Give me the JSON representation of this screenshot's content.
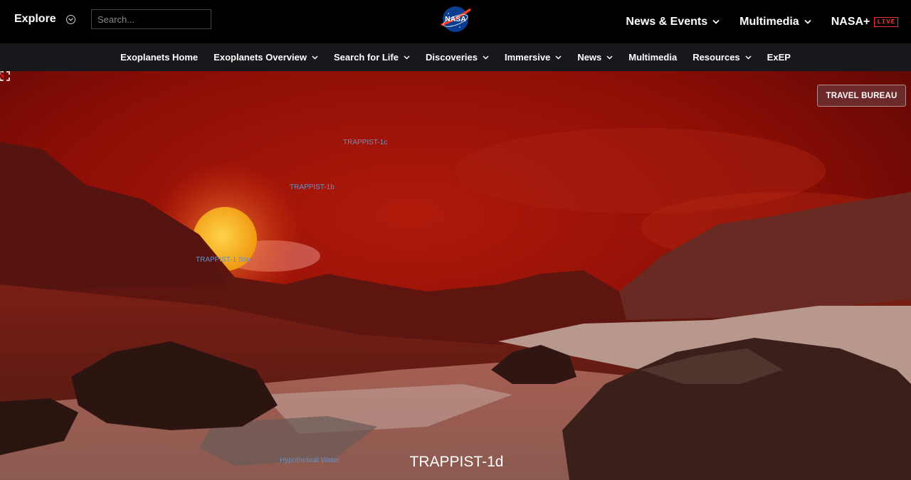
{
  "header": {
    "explore_label": "Explore",
    "search_placeholder": "Search...",
    "logo_text": "NASA",
    "nav": [
      {
        "label": "News & Events"
      },
      {
        "label": "Multimedia"
      },
      {
        "label": "NASA+",
        "badge": "LIVE"
      }
    ]
  },
  "subnav": {
    "items": [
      {
        "label": "Exoplanets Home",
        "dropdown": false
      },
      {
        "label": "Exoplanets Overview",
        "dropdown": true
      },
      {
        "label": "Search for Life",
        "dropdown": true
      },
      {
        "label": "Discoveries",
        "dropdown": true
      },
      {
        "label": "Immersive",
        "dropdown": true
      },
      {
        "label": "News",
        "dropdown": true
      },
      {
        "label": "Multimedia",
        "dropdown": false
      },
      {
        "label": "Resources",
        "dropdown": true
      },
      {
        "label": "ExEP",
        "dropdown": false
      }
    ]
  },
  "scene": {
    "travel_button": "TRAVEL BUREAU",
    "labels": {
      "planet_c": "TRAPPIST-1c",
      "planet_b": "TRAPPIST-1b",
      "star": "TRAPPIST-1 Star",
      "water": "Hypothetical Water"
    },
    "planet_title": "TRAPPIST-1d"
  },
  "colors": {
    "sky": "#8f0d06",
    "sun": "#f6b21a",
    "travel_button_bg": "#6d2a2a",
    "label_text": "#6d8fbf",
    "live_badge": "#e33333"
  }
}
